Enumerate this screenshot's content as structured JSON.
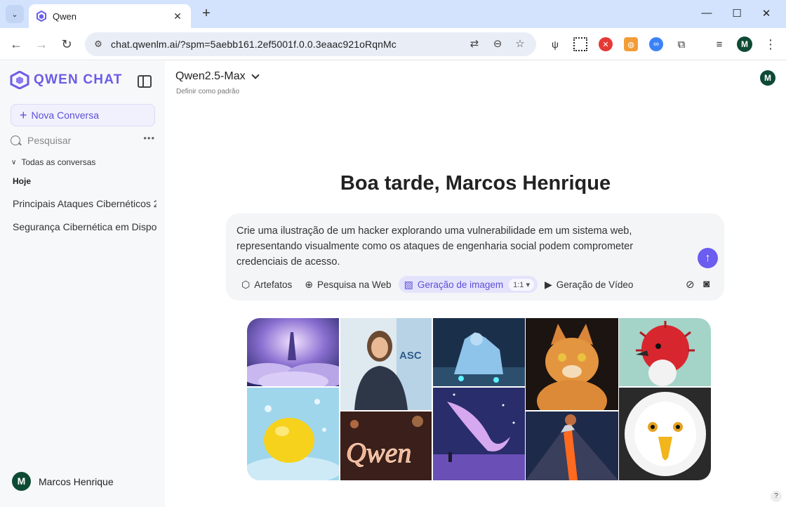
{
  "browser": {
    "tab_title": "Qwen",
    "url": "chat.qwenlm.ai/?spm=5aebb161.2ef5001f.0.0.3eaac921oRqnMc",
    "profile_initial": "M"
  },
  "sidebar": {
    "brand": "QWEN CHAT",
    "new_chat_label": "Nova Conversa",
    "search_placeholder": "Pesquisar",
    "section_label": "Todas as conversas",
    "group_label": "Hoje",
    "conversations": [
      "Principais Ataques Cibernéticos 2",
      "Segurança Cibernética em Dispos"
    ],
    "user_initial": "M",
    "user_name": "Marcos Henrique"
  },
  "main": {
    "model_name": "Qwen2.5-Max",
    "set_default": "Definir como padrão",
    "avatar_initial": "M",
    "greeting": "Boa tarde, Marcos Henrique",
    "prompt_text": "Crie uma ilustração de um hacker explorando uma vulnerabilidade em um sistema web, representando visualmente como os ataques de engenharia social podem comprometer credenciais de acesso.",
    "tools": {
      "artifacts": "Artefatos",
      "web_search": "Pesquisa na Web",
      "image_gen": "Geração de imagem",
      "ratio": "1:1 ▾",
      "video_gen": "Geração de Vídeo"
    },
    "gallery_text": {
      "conference_screen": "ASC",
      "neon_word": "Qwen"
    }
  },
  "colors": {
    "accent": "#6a5df0",
    "avatar_bg": "#0e4a34",
    "tabbar": "#d3e3fd"
  }
}
